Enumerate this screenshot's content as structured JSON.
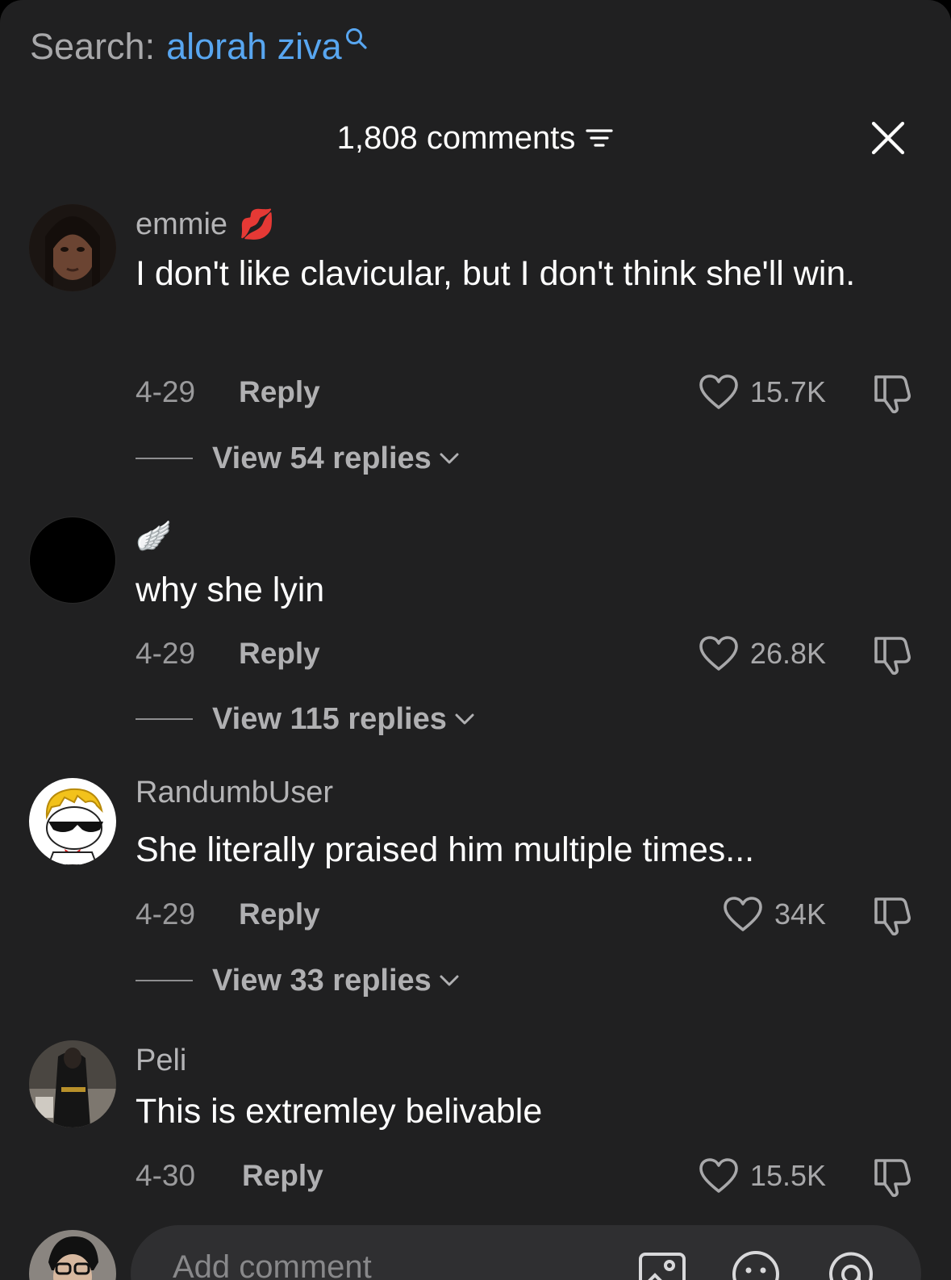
{
  "search": {
    "label": "Search:",
    "term": "alorah ziva"
  },
  "header": {
    "title": "1,808 comments"
  },
  "comments": [
    {
      "username": "emmie",
      "emoji": "💋",
      "text": "I don't like clavicular, but I don't think she'll win.",
      "date": "4-29",
      "reply_label": "Reply",
      "likes": "15.7K",
      "view_replies": "View 54 replies"
    },
    {
      "username": "",
      "emoji": "🪽",
      "text": "why she lyin",
      "date": "4-29",
      "reply_label": "Reply",
      "likes": "26.8K",
      "view_replies": "View 115 replies"
    },
    {
      "username": "RandumbUser",
      "emoji": "",
      "text": "She literally praised him multiple times...",
      "date": "4-29",
      "reply_label": "Reply",
      "likes": "34K",
      "view_replies": "View 33 replies"
    },
    {
      "username": "Peli",
      "emoji": "",
      "text": "This is extremley belivable",
      "date": "4-30",
      "reply_label": "Reply",
      "likes": "15.5K"
    }
  ],
  "footer": {
    "placeholder": "Add comment"
  },
  "colors": {
    "accent": "#58a6f0",
    "background": "#202021",
    "input": "#2f2f31"
  },
  "icons": [
    "search-icon",
    "sort-icon",
    "close-icon",
    "heart-icon",
    "dislike-icon",
    "chevron-down-icon",
    "image-icon",
    "emoji-icon",
    "mention-icon"
  ]
}
